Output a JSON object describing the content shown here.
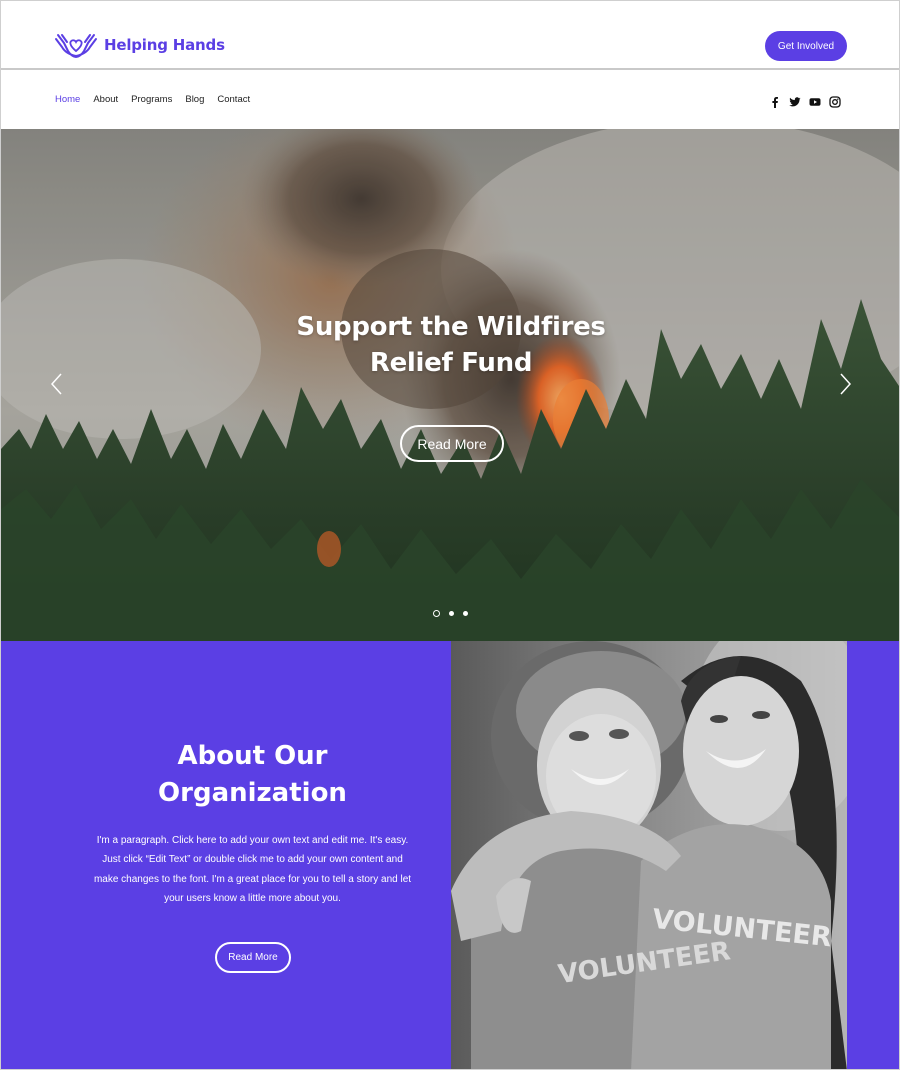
{
  "brand": {
    "name": "Helping Hands",
    "accent_color": "#5b3fe4",
    "logo_icon": "hands-heart-icon"
  },
  "header": {
    "cta_label": "Get Involved"
  },
  "nav": {
    "items": [
      {
        "label": "Home",
        "active": true
      },
      {
        "label": "About",
        "active": false
      },
      {
        "label": "Programs",
        "active": false
      },
      {
        "label": "Blog",
        "active": false
      },
      {
        "label": "Contact",
        "active": false
      }
    ],
    "social_icons": [
      "facebook-icon",
      "twitter-icon",
      "youtube-icon",
      "instagram-icon"
    ]
  },
  "hero": {
    "title_line1": "Support the Wildfires",
    "title_line2": "Relief Fund",
    "button_label": "Read More",
    "slide_count": 3,
    "active_slide": 1,
    "image": "forest-wildfire-photo"
  },
  "about": {
    "title_line1": "About Our",
    "title_line2": "Organization",
    "paragraph": "I'm a paragraph. Click here to add your own text and edit me. It's easy. Just click “Edit Text” or double click me to add your own content and make changes to the font. I'm a great place for you to tell a story and let your users know a little more about you.",
    "button_label": "Read More",
    "image": "volunteers-photo",
    "shirt_text": "VOLUNTEER"
  }
}
